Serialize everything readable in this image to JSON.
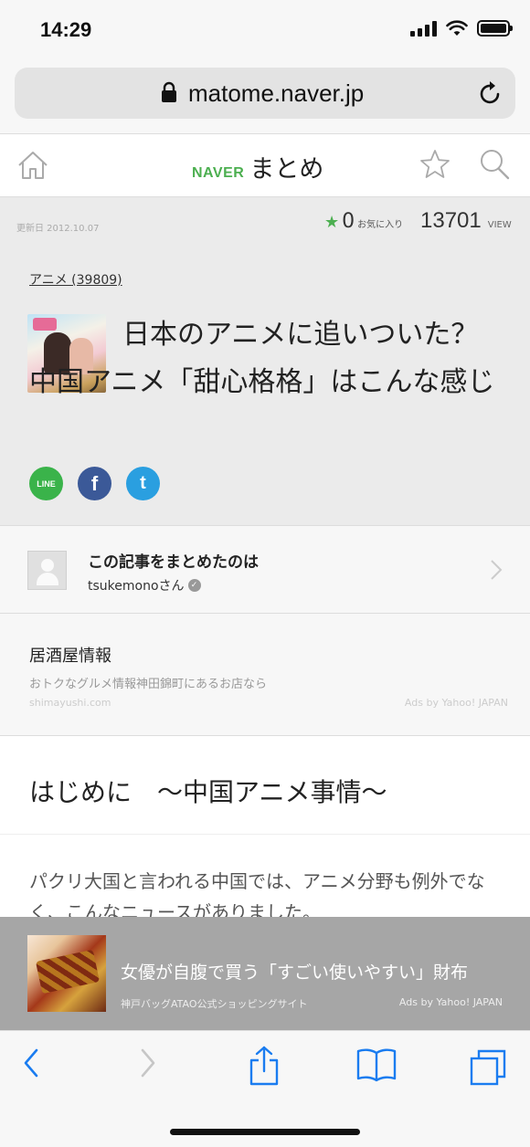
{
  "status_bar": {
    "time": "14:29"
  },
  "browser": {
    "url": "matome.naver.jp"
  },
  "site_header": {
    "brand_naver": "NAVER",
    "brand_matome": "まとめ"
  },
  "article": {
    "updated": "更新日 2012.10.07",
    "favorites_count": "0",
    "favorites_label": "お気に入り",
    "views_count": "13701",
    "views_label": "VIEW",
    "category": "アニメ (39809)",
    "title": "日本のアニメに追いついた？中国アニメ「甜心格格」はこんな感じ",
    "share": {
      "line": "LINE",
      "facebook": "f",
      "twitter": "t"
    }
  },
  "curator": {
    "label": "この記事をまとめたのは",
    "username": "tsukemonoさん"
  },
  "ad": {
    "title": "居酒屋情報",
    "description": "おトクなグルメ情報神田錦町にあるお店なら",
    "domain": "shimayushi.com",
    "ads_by": "Ads by Yahoo! JAPAN"
  },
  "section": {
    "heading": "はじめに　～中国アニメ事情～"
  },
  "body": {
    "paragraph": "パクリ大国と言われる中国では、アニメ分野も例外でなく、こんなニュースがありました。"
  },
  "bottom_ad": {
    "headline": "女優が自腹で買う「すごい使いやすい」財布",
    "sub": "神戸バッグATAO公式ショッピングサイト",
    "ads_by": "Ads by Yahoo! JAPAN"
  },
  "colors": {
    "accent_green": "#4caf50",
    "safari_blue": "#1a7cf0"
  }
}
